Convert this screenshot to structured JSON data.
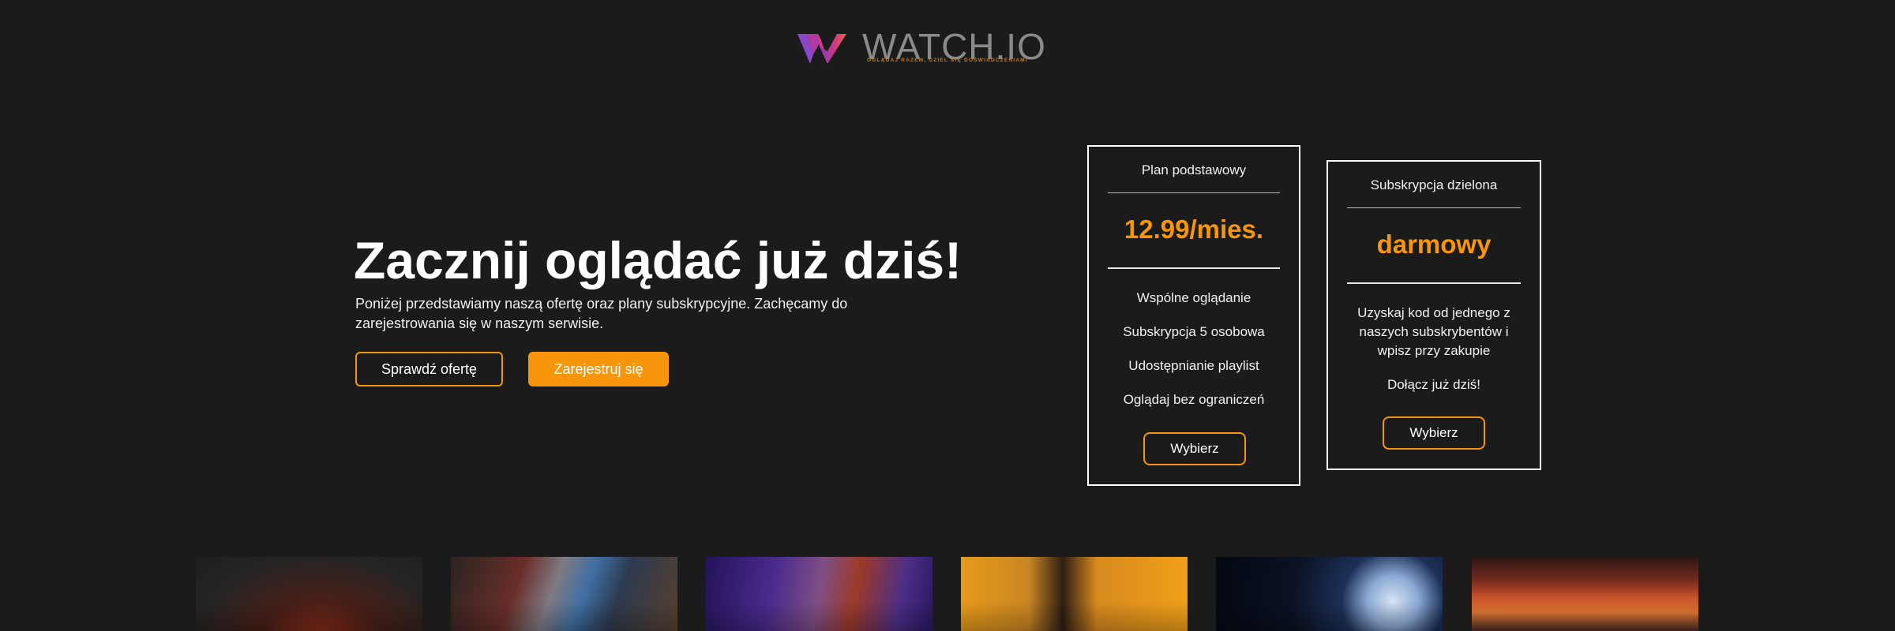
{
  "brand": {
    "name": "WATCH.IO",
    "tagline": "OGLĄDAJ RAZEM, DZIEL SIĘ DOŚWIADCZENIAMI",
    "logo_icon": "w-logo-icon",
    "accent_color": "#f7960a"
  },
  "hero": {
    "title": "Zacznij oglądać już dziś!",
    "description": "Poniżej przedstawiamy naszą ofertę oraz plany subskrypcyjne. Zachęcamy do zarejestrowania się w naszym serwisie.",
    "offer_button": "Sprawdź ofertę",
    "register_button": "Zarejestruj się"
  },
  "plans": [
    {
      "title": "Plan podstawowy",
      "price": "12.99/mies.",
      "features": [
        "Wspólne oglądanie",
        "Subskrypcja 5 osobowa",
        "Udostępnianie playlist",
        "Oglądaj bez ograniczeń"
      ],
      "button": "Wybierz"
    },
    {
      "title": "Subskrypcja dzielona",
      "price": "darmowy",
      "note": "Uzyskaj kod od jednego z naszych subskrybentów i wpisz przy zakupie",
      "cta_text": "Dołącz już dziś!",
      "button": "Wybierz"
    }
  ],
  "posters": [
    "poster-1",
    "poster-2",
    "poster-3",
    "poster-4",
    "poster-5",
    "poster-6"
  ]
}
